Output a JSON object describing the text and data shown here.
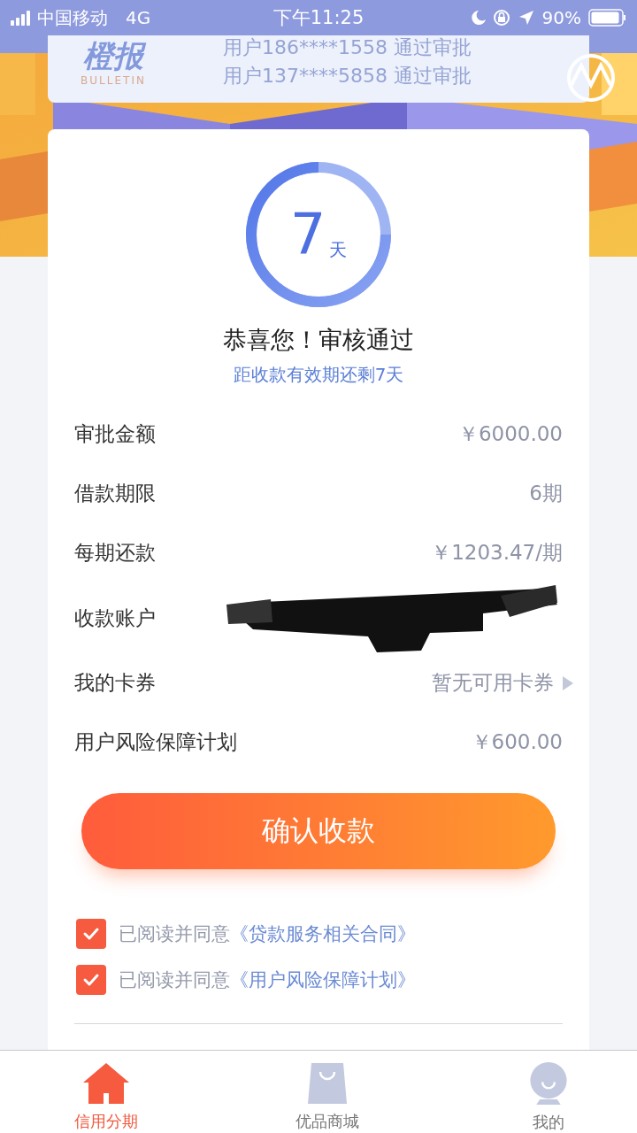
{
  "status_bar": {
    "carrier": "中国移动",
    "network": "4G",
    "time": "下午11:25",
    "battery": "90%"
  },
  "bulletin": {
    "logo": "橙报",
    "logo_sub": "BULLETIN",
    "messages": [
      "用户186****1558 通过审批",
      "用户137****5858 通过审批"
    ]
  },
  "countdown": {
    "number": "7",
    "unit": "天"
  },
  "title": "恭喜您！审核通过",
  "subtitle": "距收款有效期还剩7天",
  "details": [
    {
      "kind": "text",
      "label": "审批金额",
      "value": "￥6000.00"
    },
    {
      "kind": "text",
      "label": "借款期限",
      "value": "6期"
    },
    {
      "kind": "text",
      "label": "每期还款",
      "value": "￥1203.47/期"
    },
    {
      "kind": "redacted",
      "label": "收款账户"
    },
    {
      "kind": "link",
      "label": "我的卡券",
      "value": "暂无可用卡券"
    },
    {
      "kind": "text",
      "label": "用户风险保障计划",
      "value": "￥600.00"
    }
  ],
  "confirm_button": "确认收款",
  "agreements": [
    {
      "text": "已阅读并同意",
      "link": "《贷款服务相关合同》",
      "checked": true
    },
    {
      "text": "已阅读并同意",
      "link": "《用户风险保障计划》",
      "checked": true
    }
  ],
  "tabs": [
    {
      "label": "信用分期",
      "selected": true
    },
    {
      "label": "优品商城",
      "selected": false
    },
    {
      "label": "我的",
      "selected": false
    }
  ]
}
